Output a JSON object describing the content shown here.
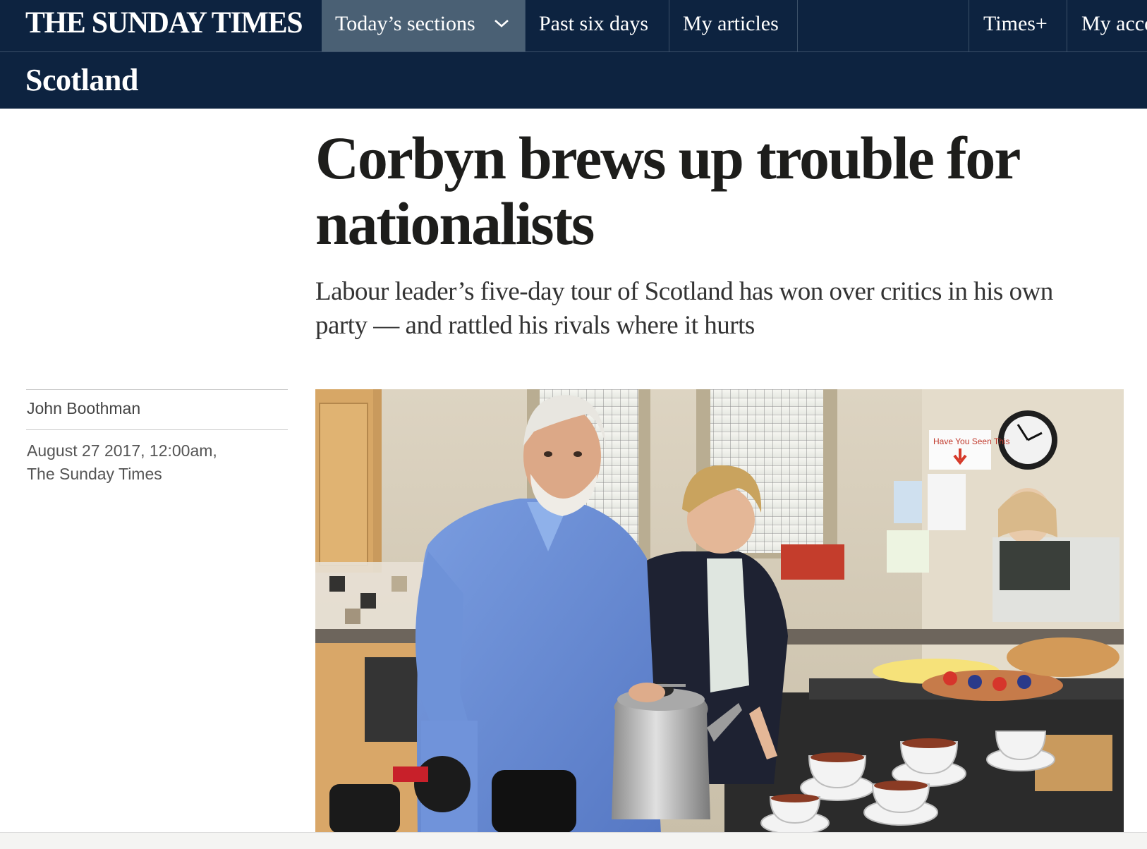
{
  "header": {
    "masthead": "THE SUNDAY TIMES",
    "nav": {
      "todays_sections": "Today’s sections",
      "past_six_days": "Past six days",
      "my_articles": "My articles",
      "times_plus": "Times+",
      "my_account": "My acco"
    },
    "section": "Scotland"
  },
  "article": {
    "headline_line1": "Corbyn brews up trouble for",
    "headline_line2": "nationalists",
    "standfirst": "Labour leader’s five-day tour of Scotland has won over critics in his own party — and rattled his rivals where it hurts",
    "author": "John Boothman",
    "date": "August 27 2017, 12:00am,",
    "publication": "The Sunday Times"
  },
  "photo": {
    "poster_text": "Have You Seen This"
  },
  "colors": {
    "nav_background": "#0d2340",
    "nav_active": "#4a6074",
    "headline": "#1d1d1b"
  },
  "icons": {
    "sections_dropdown": "chevron-down-icon"
  }
}
